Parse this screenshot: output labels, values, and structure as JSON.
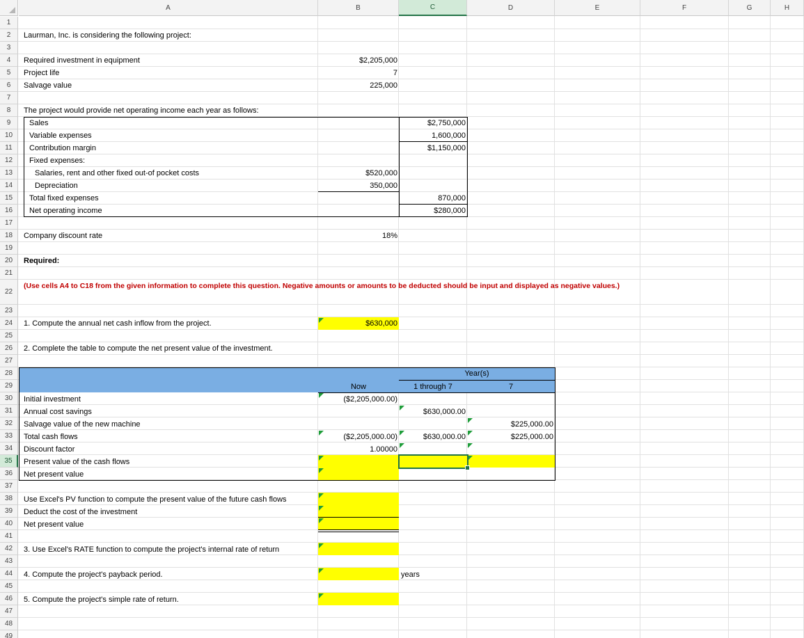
{
  "columns": [
    "A",
    "B",
    "C",
    "D",
    "E",
    "F",
    "G",
    "H"
  ],
  "rows": [
    "1",
    "2",
    "3",
    "4",
    "5",
    "6",
    "7",
    "8",
    "9",
    "10",
    "11",
    "12",
    "13",
    "14",
    "15",
    "16",
    "17",
    "18",
    "19",
    "20",
    "21",
    "22",
    "23",
    "24",
    "25",
    "26",
    "27",
    "28",
    "29",
    "30",
    "31",
    "32",
    "33",
    "34",
    "35",
    "36",
    "37",
    "38",
    "39",
    "40",
    "41",
    "42",
    "43",
    "44",
    "45",
    "46",
    "47",
    "48",
    "49"
  ],
  "intro": "Laurman, Inc. is considering the following project:",
  "inputs": {
    "investment_label": "Required investment in equipment",
    "investment_value": "$2,205,000",
    "life_label": "Project life",
    "life_value": "7",
    "salvage_label": "Salvage value",
    "salvage_value": "225,000"
  },
  "income": {
    "heading": "The project would provide net operating income each year as follows:",
    "sales_label": "Sales",
    "sales_value": "$2,750,000",
    "variable_label": "Variable expenses",
    "variable_value": "1,600,000",
    "cm_label": "Contribution margin",
    "cm_value": "$1,150,000",
    "fixed_label": "Fixed expenses:",
    "salaries_label": "Salaries, rent and other fixed out-of pocket costs",
    "salaries_value": "$520,000",
    "depreciation_label": "Depreciation",
    "depreciation_value": "350,000",
    "total_fixed_label": "Total fixed expenses",
    "total_fixed_value": "870,000",
    "noi_label": "Net operating income",
    "noi_value": "$280,000"
  },
  "discount": {
    "label": "Company discount rate",
    "value": "18%"
  },
  "required_label": "Required:",
  "instruction": "(Use cells A4 to C18 from the given information to complete this question. Negative amounts or amounts to be deducted should be input and displayed as negative values.)",
  "q1": {
    "label": "1. Compute the annual net cash inflow from the project.",
    "answer": "$630,000"
  },
  "q2": {
    "label": "2. Complete the table to compute the net present value of the investment.",
    "years_header": "Year(s)",
    "col_now": "Now",
    "col_1to7": "1 through 7",
    "col_7": "7",
    "initial_label": "Initial investment",
    "initial_now": "($2,205,000.00)",
    "annual_label": "Annual cost savings",
    "annual_1to7": "$630,000.00",
    "salvage_label": "Salvage value of the new machine",
    "salvage_7": "$225,000.00",
    "total_label": "Total cash flows",
    "total_now": "($2,205,000.00)",
    "total_1to7": "$630,000.00",
    "total_7": "$225,000.00",
    "factor_label": "Discount factor",
    "factor_now": "1.00000",
    "pv_label": "Present value of the cash flows",
    "npv_label": "Net present value"
  },
  "pv_block": {
    "pv_label": "Use Excel's PV function to compute the present value of the future cash flows",
    "deduct_label": "Deduct the cost of the investment",
    "npv_label": "Net present value"
  },
  "q3": {
    "label": "3. Use Excel's RATE function to compute the project's internal rate of return"
  },
  "q4": {
    "label": "4. Compute the project's payback period.",
    "unit": "years"
  },
  "q5": {
    "label": "5. Compute the project's simple rate of return."
  },
  "colors": {
    "answer_fill": "#ffff00",
    "table_header": "#7aaee3",
    "instruction": "#c00000",
    "selection": "#217346"
  }
}
